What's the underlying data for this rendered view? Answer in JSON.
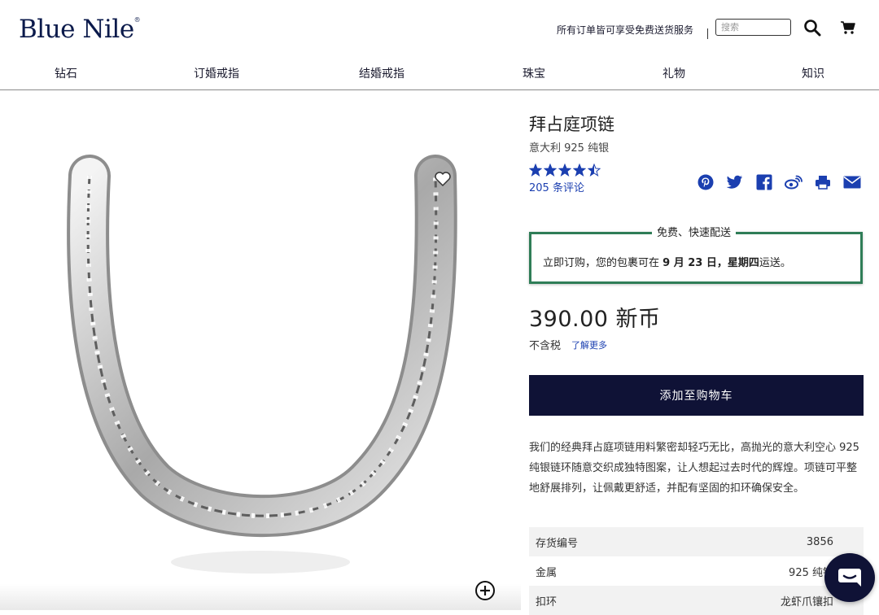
{
  "header": {
    "logo_text": "Blue Nile",
    "shipping_note": "所有订单皆可享受免费送货服务",
    "search_placeholder": "搜索",
    "search_icon": "search-icon",
    "cart_icon": "cart-icon"
  },
  "nav": {
    "items": [
      {
        "label": "钻石"
      },
      {
        "label": "订婚戒指"
      },
      {
        "label": "结婚戒指"
      },
      {
        "label": "珠宝"
      },
      {
        "label": "礼物"
      },
      {
        "label": "知识"
      }
    ]
  },
  "product": {
    "title": "拜占庭项链",
    "subtitle": "意大利 925 纯银",
    "rating": 4.5,
    "rating_max": 5,
    "reviews_label": "205 条评论",
    "share_icons": [
      "pinterest-icon",
      "twitter-icon",
      "facebook-icon",
      "weibo-icon",
      "print-icon",
      "email-icon"
    ],
    "delivery": {
      "legend": "免费、快速配送",
      "prefix": "立即订购，您的包裹可在 ",
      "date": "9 月 23 日",
      "sep": "，",
      "weekday": "星期四",
      "suffix": "运送。"
    },
    "price": "390.00 新币",
    "tax_note": "不含税",
    "learn_more": "了解更多",
    "add_to_cart": "添加至购物车",
    "description": "我们的经典拜占庭项链用料繁密却轻巧无比，高抛光的意大利空心 925 纯银链环随意交织成独特图案，让人想起过去时代的辉煌。项链可平整地舒展排列，让佩戴更舒适，并配有坚固的扣环确保安全。",
    "specs": [
      {
        "label": "存货编号",
        "value": "3856"
      },
      {
        "label": "金属",
        "value": "925 纯银"
      },
      {
        "label": "扣环",
        "value": "龙虾爪镶扣"
      }
    ]
  },
  "colors": {
    "brand_navy": "#0f1236",
    "link_blue": "#1b3fb0",
    "delivery_green": "#2f7d57"
  }
}
